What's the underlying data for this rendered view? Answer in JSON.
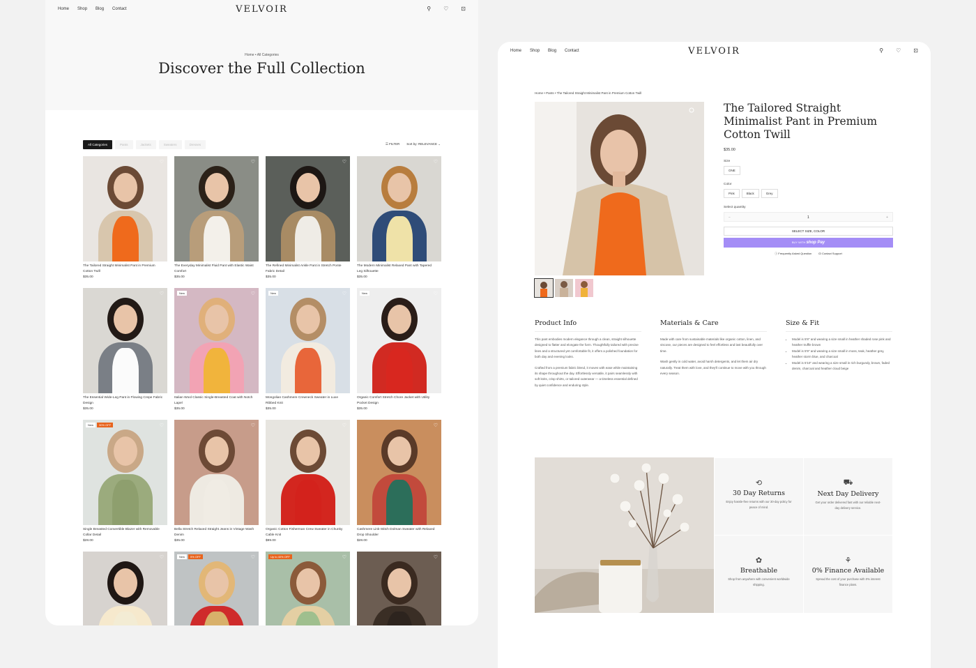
{
  "nav": {
    "links": [
      "Home",
      "Shop",
      "Blog",
      "Contact"
    ],
    "logo": "VELVOIR",
    "icons": [
      "search-icon",
      "heart-icon",
      "cart-icon"
    ]
  },
  "catalog": {
    "breadcrumb": "Home • All Categories",
    "title": "Discover the Full Collection",
    "tabs": [
      "All Categories",
      "Pants",
      "Jackets",
      "Sweaters",
      "Dresses"
    ],
    "filter_label": "FILTER",
    "sort_label": "Sort by: RELEVANCE",
    "products": [
      {
        "name": "The Tailored Straight Minimalist Pant in Premium Cotton Twill",
        "price": "$35.00",
        "badges": [],
        "colors": {
          "bg": "#e9e5e1",
          "top": "#ef6a1c",
          "coat": "#d8c6ad",
          "hair": "#6b4a35"
        }
      },
      {
        "name": "The Everyday Minimalist Fluid Pant with Elastic Waist Comfort",
        "price": "$35.00",
        "badges": [],
        "colors": {
          "bg": "#8a8d86",
          "top": "#f3f0ea",
          "coat": "#b89d7a",
          "hair": "#2b2118"
        }
      },
      {
        "name": "The Refined Minimalist Ankle Pant in Stretch Ponte Fabric Detail",
        "price": "$35.00",
        "badges": [],
        "colors": {
          "bg": "#5b5f5a",
          "top": "#efece6",
          "coat": "#a88b64",
          "hair": "#1d1714"
        }
      },
      {
        "name": "The Modern Minimalist Relaxed Pant with Tapered Leg Silhouette",
        "price": "$35.00",
        "badges": [],
        "colors": {
          "bg": "#d9d7d2",
          "top": "#efe2a8",
          "coat": "#2f4c78",
          "hair": "#b87d3e"
        }
      },
      {
        "name": "The Essential Wide-Leg Pant in Flowing Crepe Fabric Design",
        "price": "$35.00",
        "badges": [],
        "colors": {
          "bg": "#dad8d3",
          "top": "#fbfbfb",
          "coat": "#7a7f86",
          "hair": "#221a16"
        }
      },
      {
        "name": "Italian Wool Classic Single-Breasted Coat with Notch Lapel",
        "price": "$35.00",
        "badges": [
          "New"
        ],
        "colors": {
          "bg": "#d4b8c3",
          "top": "#f1b43c",
          "coat": "#f2a3b4",
          "hair": "#e0b07a"
        }
      },
      {
        "name": "Mongolian Cashmere Crewneck Sweater in Luxe Ribbed Knit",
        "price": "$35.00",
        "badges": [
          "New"
        ],
        "colors": {
          "bg": "#d8dfe6",
          "top": "#e8663a",
          "coat": "#f2ebe0",
          "hair": "#b48e66"
        }
      },
      {
        "name": "Organic Comfort Stretch Chore Jacket with Utility Pocket Design",
        "price": "$35.00",
        "badges": [
          "New"
        ],
        "colors": {
          "bg": "#eeeeee",
          "top": "#d8271f",
          "coat": "#d12a22",
          "hair": "#2a1d18"
        }
      },
      {
        "name": "Single Breasted Convertible Blazer with Removable Collar Detail",
        "price": "$28.00",
        "badges": [
          "New",
          "30% OFF"
        ],
        "colors": {
          "bg": "#dfe3e0",
          "top": "#8e9f6e",
          "coat": "#9bab7d",
          "hair": "#c9a887"
        }
      },
      {
        "name": "Bella Stretch Relaxed Straight Jeans in Vintage Wash Denim",
        "price": "$35.00",
        "badges": [],
        "colors": {
          "bg": "#c79c8a",
          "top": "#f0ece4",
          "coat": "#eeeae2",
          "hair": "#6d4a36"
        }
      },
      {
        "name": "Organic Cotton Fisherman Crew Sweater in Chunky Cable Knit",
        "price": "$99.00",
        "badges": [],
        "colors": {
          "bg": "#e7e5e0",
          "top": "#d3221c",
          "coat": "#d3261f",
          "hair": "#6c4a35"
        }
      },
      {
        "name": "Cashmere Link-Stitch Dolman Sweater with Relaxed Drop Shoulder",
        "price": "$28.00",
        "badges": [],
        "colors": {
          "bg": "#c98e5e",
          "top": "#2c6e5a",
          "coat": "#c24a3c",
          "hair": "#5a3a28"
        }
      },
      {
        "name": "",
        "price": "",
        "badges": [],
        "colors": {
          "bg": "#d7d3cf",
          "top": "#f3ecd4",
          "coat": "#f6e9cd",
          "hair": "#1f1714"
        }
      },
      {
        "name": "",
        "price": "",
        "badges": [
          "New",
          "5% OFF"
        ],
        "colors": {
          "bg": "#bfc3c4",
          "top": "#d8b06a",
          "coat": "#cf2b2b",
          "hair": "#e2b777"
        }
      },
      {
        "name": "",
        "price": "",
        "badges": [
          "Up to 40% OFF"
        ],
        "colors": {
          "bg": "#a9bfa8",
          "top": "#9fbf8e",
          "coat": "#e4cfa3",
          "hair": "#8b5a3a"
        }
      },
      {
        "name": "",
        "price": "",
        "badges": [],
        "colors": {
          "bg": "#6c5d52",
          "top": "#2d241e",
          "coat": "#3a2e25",
          "hair": "#3a2a20"
        }
      }
    ]
  },
  "product": {
    "breadcrumb": "Home • Pants • The Tailored Straight Minimalist Pant in Premium Cotton Twill",
    "title": "The Tailored Straight Minimalist Pant in Premium Cotton Twill",
    "price": "$35.00",
    "size_label": "Size",
    "sizes": [
      "ONE"
    ],
    "color_label": "Color",
    "colors": [
      "Pink",
      "Black",
      "Grey"
    ],
    "quantity_label": "Select quantity",
    "quantity": "1",
    "minus": "−",
    "plus": "+",
    "select_button": "SELECT SIZE, COLOR",
    "buy_with": "BUY WITH",
    "shop_pay": "shop Pay",
    "faq_label": "Frequently Asked Question",
    "support_label": "Contact Support",
    "sections": {
      "info_title": "Product Info",
      "info_p1": "This pant embodies modern elegance through a clean, straight silhouette designed to flatter and elongate the form. Thoughtfully tailored with precise lines and a structured yet comfortable fit, it offers a polished foundation for both day and evening looks.",
      "info_p2": "Crafted from a premium fabric blend, it moves with ease while maintaining its shape throughout the day. Effortlessly versatile, it pairs seamlessly with soft knits, crisp shirts, or tailored outerwear — a timeless essential defined by quiet confidence and enduring style.",
      "care_title": "Materials & Care",
      "care_p1": "Made with care from sustainable materials like organic cotton, linen, and viscose, our pieces are designed to feel effortless and last beautifully over time.",
      "care_p2": "Wash gently in cold water, avoid harsh detergents, and let them air dry naturally. Treat them with love, and they'll continue to move with you through every season.",
      "fit_title": "Size & Fit",
      "fit_items": [
        "Model is 5'8\" and wearing a size small in heather shaded rose pink and heather truffle brown",
        "Model is 5'9\" and wearing a size small in moss, teak, heather grey, heather storm blue, and charcoal",
        "Model is 5'10\" and wearing a size small in rich burgundy, brown, faded denim, charcoal and heather cloud beige"
      ]
    },
    "features": [
      {
        "icon": "⟲",
        "icon_name": "returns-icon",
        "title": "30 Day Returns",
        "text": "Enjoy hassle-free returns with our 30-day policy for peace of mind."
      },
      {
        "icon": "⛟",
        "icon_name": "truck-icon",
        "title": "Next Day Delivery",
        "text": "Get your order delivered fast with our reliable next-day delivery service."
      },
      {
        "icon": "✿",
        "icon_name": "leaf-icon",
        "title": "Breathable",
        "text": "Shop from anywhere with convenient worldwide shipping."
      },
      {
        "icon": "⚘",
        "icon_name": "plant-icon",
        "title": "0% Finance Available",
        "text": "Spread the cost of your purchase with 0% interest finance plans."
      }
    ]
  },
  "accent": {
    "orange": "#ef6a1c",
    "shop_pay": "#a48df6",
    "dark": "#1a1a1a"
  }
}
